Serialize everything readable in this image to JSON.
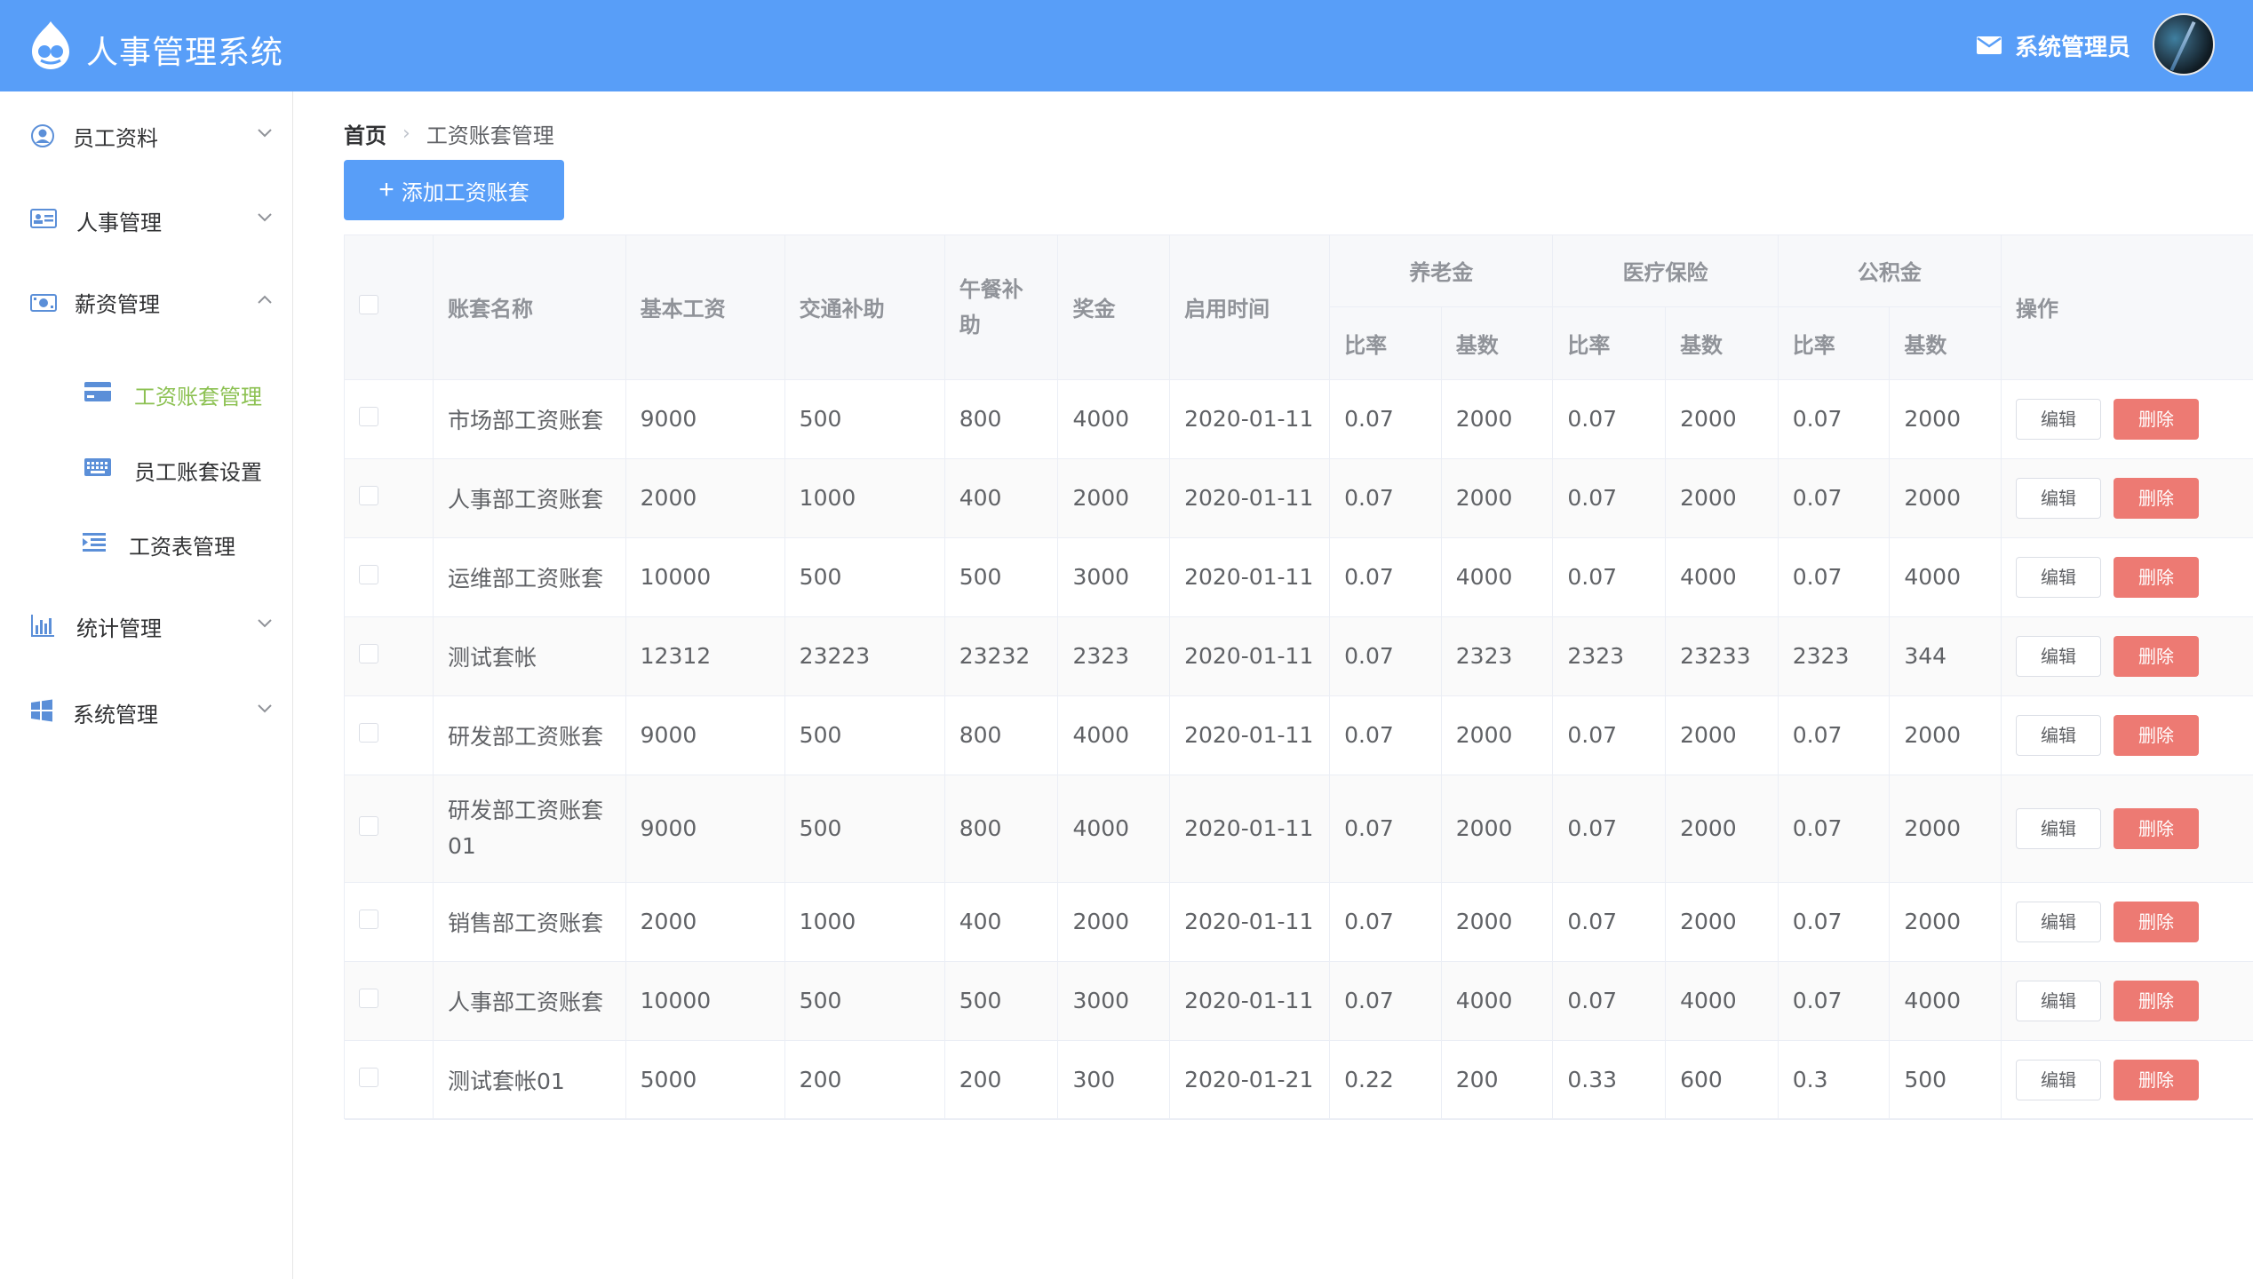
{
  "header": {
    "app_title": "人事管理系统",
    "user_name": "系统管理员",
    "brand_color": "#589ef8"
  },
  "sidebar": {
    "items": [
      {
        "label": "员工资料",
        "icon": "user-circle-icon"
      },
      {
        "label": "人事管理",
        "icon": "id-card-icon"
      },
      {
        "label": "薪资管理",
        "icon": "money-icon",
        "expanded": true,
        "children": [
          {
            "label": "工资账套管理",
            "icon": "credit-card-icon",
            "active": true
          },
          {
            "label": "员工账套设置",
            "icon": "keyboard-icon"
          },
          {
            "label": "工资表管理",
            "icon": "list-indent-icon"
          }
        ]
      },
      {
        "label": "统计管理",
        "icon": "bar-chart-icon"
      },
      {
        "label": "系统管理",
        "icon": "windows-icon"
      }
    ],
    "active_color": "#8cc152"
  },
  "breadcrumb": {
    "home": "首页",
    "current": "工资账套管理"
  },
  "toolbar": {
    "add_label": "添加工资账套"
  },
  "table": {
    "headers": {
      "name": "账套名称",
      "basic": "基本工资",
      "traffic": "交通补助",
      "lunch": "午餐补助",
      "bonus": "奖金",
      "start": "启用时间",
      "pension": "养老金",
      "medical": "医疗保险",
      "fund": "公积金",
      "rate": "比率",
      "base": "基数",
      "ops": "操作"
    },
    "edit_label": "编辑",
    "delete_label": "删除",
    "rows": [
      {
        "name": "市场部工资账套",
        "basic": "9000",
        "traffic": "500",
        "lunch": "800",
        "bonus": "4000",
        "start": "2020-01-11",
        "pension_rate": "0.07",
        "pension_base": "2000",
        "medical_rate": "0.07",
        "medical_base": "2000",
        "fund_rate": "0.07",
        "fund_base": "2000"
      },
      {
        "name": "人事部工资账套",
        "basic": "2000",
        "traffic": "1000",
        "lunch": "400",
        "bonus": "2000",
        "start": "2020-01-11",
        "pension_rate": "0.07",
        "pension_base": "2000",
        "medical_rate": "0.07",
        "medical_base": "2000",
        "fund_rate": "0.07",
        "fund_base": "2000"
      },
      {
        "name": "运维部工资账套",
        "basic": "10000",
        "traffic": "500",
        "lunch": "500",
        "bonus": "3000",
        "start": "2020-01-11",
        "pension_rate": "0.07",
        "pension_base": "4000",
        "medical_rate": "0.07",
        "medical_base": "4000",
        "fund_rate": "0.07",
        "fund_base": "4000"
      },
      {
        "name": "测试套帐",
        "basic": "12312",
        "traffic": "23223",
        "lunch": "23232",
        "bonus": "2323",
        "start": "2020-01-11",
        "pension_rate": "0.07",
        "pension_base": "2323",
        "medical_rate": "2323",
        "medical_base": "23233",
        "fund_rate": "2323",
        "fund_base": "344"
      },
      {
        "name": "研发部工资账套",
        "basic": "9000",
        "traffic": "500",
        "lunch": "800",
        "bonus": "4000",
        "start": "2020-01-11",
        "pension_rate": "0.07",
        "pension_base": "2000",
        "medical_rate": "0.07",
        "medical_base": "2000",
        "fund_rate": "0.07",
        "fund_base": "2000"
      },
      {
        "name": "研发部工资账套01",
        "basic": "9000",
        "traffic": "500",
        "lunch": "800",
        "bonus": "4000",
        "start": "2020-01-11",
        "pension_rate": "0.07",
        "pension_base": "2000",
        "medical_rate": "0.07",
        "medical_base": "2000",
        "fund_rate": "0.07",
        "fund_base": "2000"
      },
      {
        "name": "销售部工资账套",
        "basic": "2000",
        "traffic": "1000",
        "lunch": "400",
        "bonus": "2000",
        "start": "2020-01-11",
        "pension_rate": "0.07",
        "pension_base": "2000",
        "medical_rate": "0.07",
        "medical_base": "2000",
        "fund_rate": "0.07",
        "fund_base": "2000"
      },
      {
        "name": "人事部工资账套",
        "basic": "10000",
        "traffic": "500",
        "lunch": "500",
        "bonus": "3000",
        "start": "2020-01-11",
        "pension_rate": "0.07",
        "pension_base": "4000",
        "medical_rate": "0.07",
        "medical_base": "4000",
        "fund_rate": "0.07",
        "fund_base": "4000"
      },
      {
        "name": "测试套帐01",
        "basic": "5000",
        "traffic": "200",
        "lunch": "200",
        "bonus": "300",
        "start": "2020-01-21",
        "pension_rate": "0.22",
        "pension_base": "200",
        "medical_rate": "0.33",
        "medical_base": "600",
        "fund_rate": "0.3",
        "fund_base": "500"
      }
    ]
  },
  "colors": {
    "delete": "#ed7a73",
    "header_bg": "#f7f8fa"
  }
}
